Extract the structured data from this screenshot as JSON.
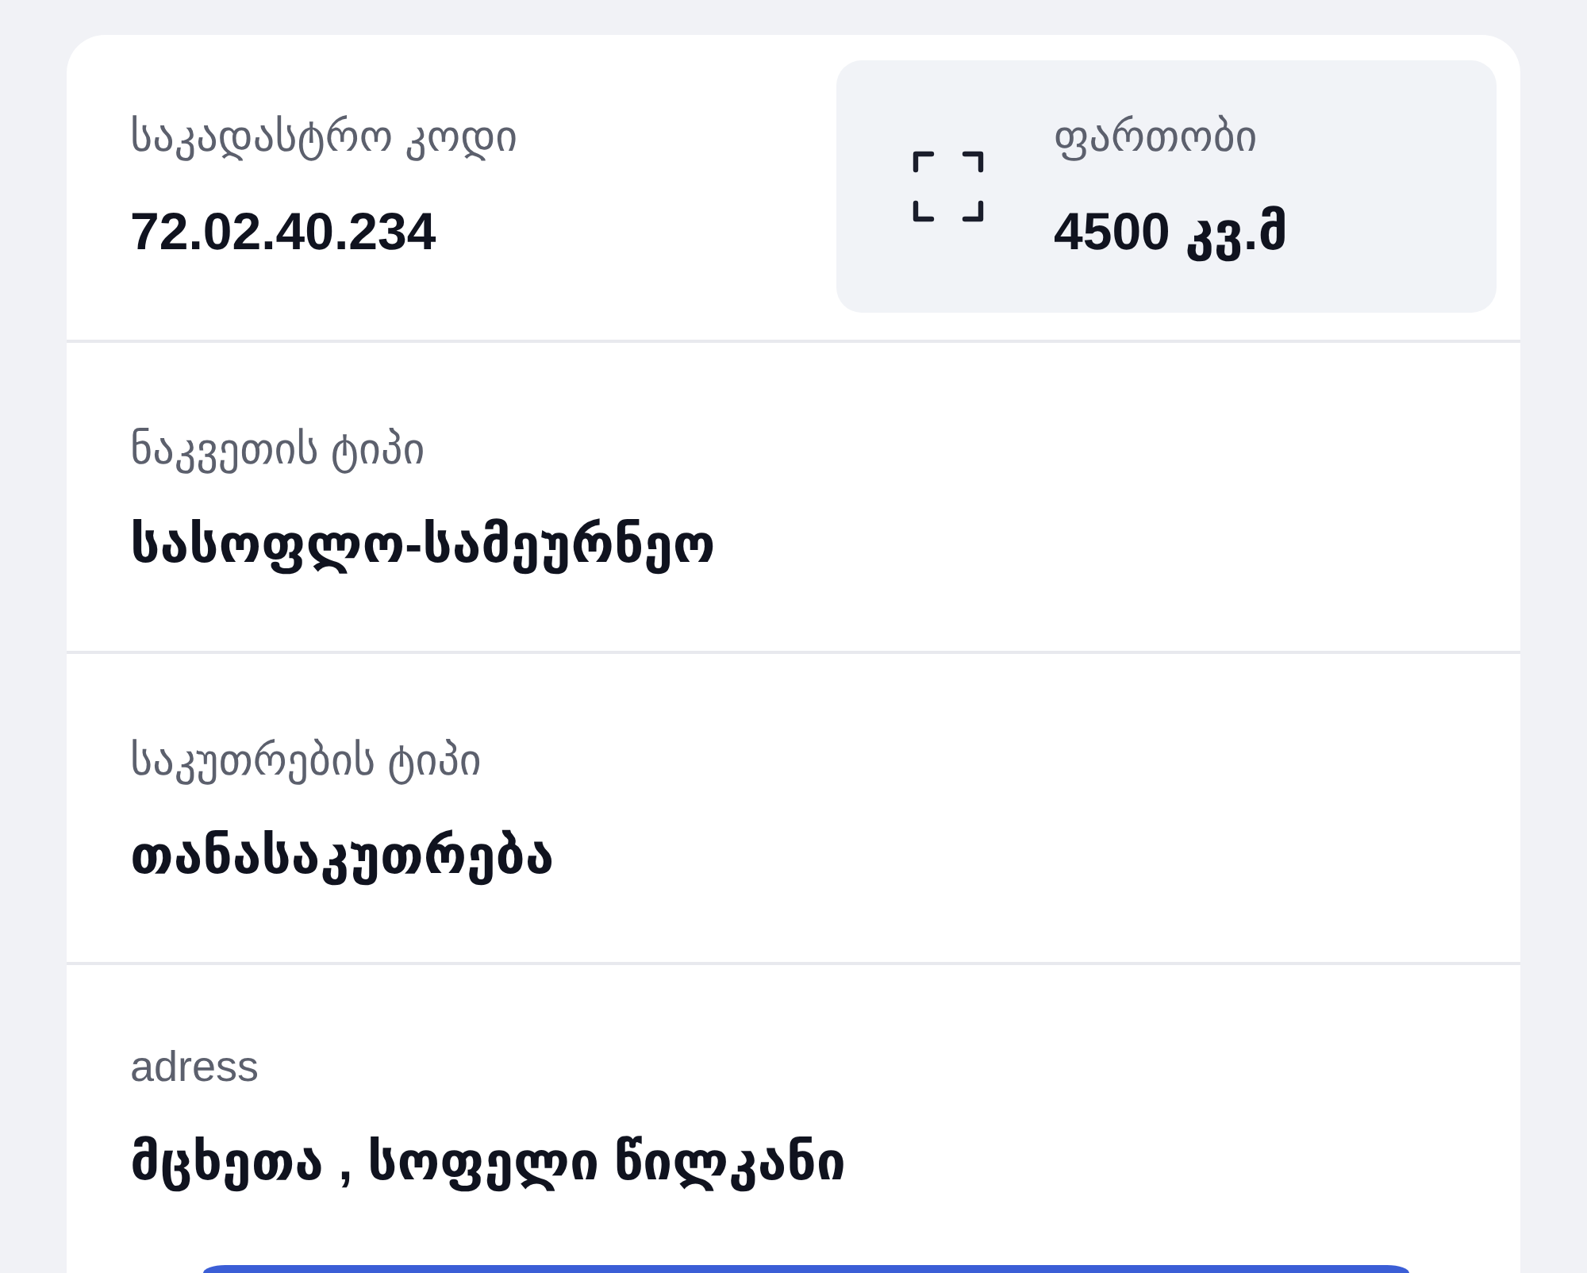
{
  "summary": [
    {
      "kind": "plain",
      "label": "საკადასტრო კოდი",
      "value": "72.02.40.234"
    },
    {
      "kind": "area",
      "label": "ფართობი",
      "value": "4500 კვ.მ"
    }
  ],
  "details": [
    {
      "label": "ნაკვეთის ტიპი",
      "value": "სასოფლო-სამეურნეო"
    },
    {
      "label": "საკუთრების ტიპი",
      "value": "თანასაკუთრება"
    },
    {
      "label": "adress",
      "value": "მცხეთა , სოფელი წილკანი"
    }
  ]
}
